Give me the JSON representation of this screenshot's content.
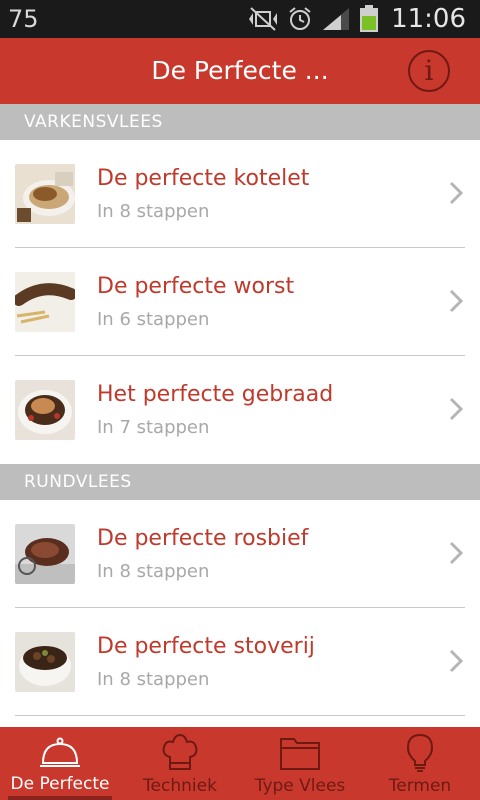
{
  "status_bar": {
    "left_text": "75",
    "time": "11:06"
  },
  "app_bar": {
    "title": "De Perfecte ...",
    "info_icon": "info-icon"
  },
  "sections": [
    {
      "header": "VARKENSVLEES",
      "items": [
        {
          "title": "De perfecte kotelet",
          "subtitle": "In 8 stappen"
        },
        {
          "title": "De perfecte worst",
          "subtitle": "In 6 stappen"
        },
        {
          "title": "Het perfecte gebraad",
          "subtitle": "In 7 stappen"
        }
      ]
    },
    {
      "header": "RUNDVLEES",
      "items": [
        {
          "title": "De perfecte rosbief",
          "subtitle": "In 8 stappen"
        },
        {
          "title": "De perfecte stoverij",
          "subtitle": "In 8 stappen"
        }
      ]
    }
  ],
  "tabs": [
    {
      "label": "De Perfecte",
      "icon": "cloche-icon",
      "active": true
    },
    {
      "label": "Techniek",
      "icon": "chef-hat-icon",
      "active": false
    },
    {
      "label": "Type Vlees",
      "icon": "folder-icon",
      "active": false
    },
    {
      "label": "Termen",
      "icon": "lightbulb-icon",
      "active": false
    }
  ],
  "colors": {
    "primary": "#c9382c",
    "primary_dark": "#6e1a13",
    "section_header": "#bdbdbd",
    "item_title": "#c0392b",
    "item_subtitle": "#a8a8a8"
  }
}
